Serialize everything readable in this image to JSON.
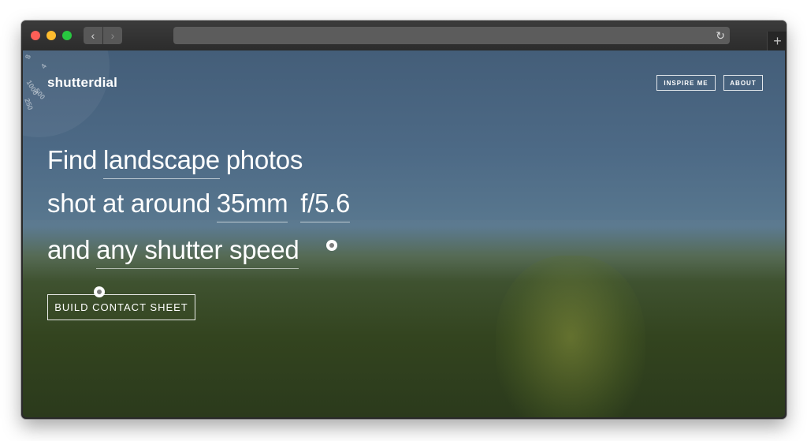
{
  "browser": {
    "back_glyph": "‹",
    "forward_glyph": "›",
    "reload_glyph": "↻",
    "new_tab_glyph": "+"
  },
  "dial": {
    "ticks": [
      "8",
      "4",
      "1000",
      "500",
      "250"
    ]
  },
  "header": {
    "brand": "shutterdial",
    "nav": [
      {
        "label": "INSPIRE ME"
      },
      {
        "label": "ABOUT"
      }
    ]
  },
  "hero": {
    "line1": {
      "prefix": "Find",
      "subject": "landscape",
      "suffix": "photos"
    },
    "line2": {
      "prefix": "shot at around",
      "focal_length": "35mm",
      "aperture": "f/5.6"
    },
    "line3": {
      "prefix": "and",
      "shutter": "any shutter speed"
    }
  },
  "cta": {
    "label": "BUILD CONTACT SHEET"
  },
  "colors": {
    "sky": "#4d6a86",
    "field": "#33441f",
    "text": "#ffffff"
  }
}
